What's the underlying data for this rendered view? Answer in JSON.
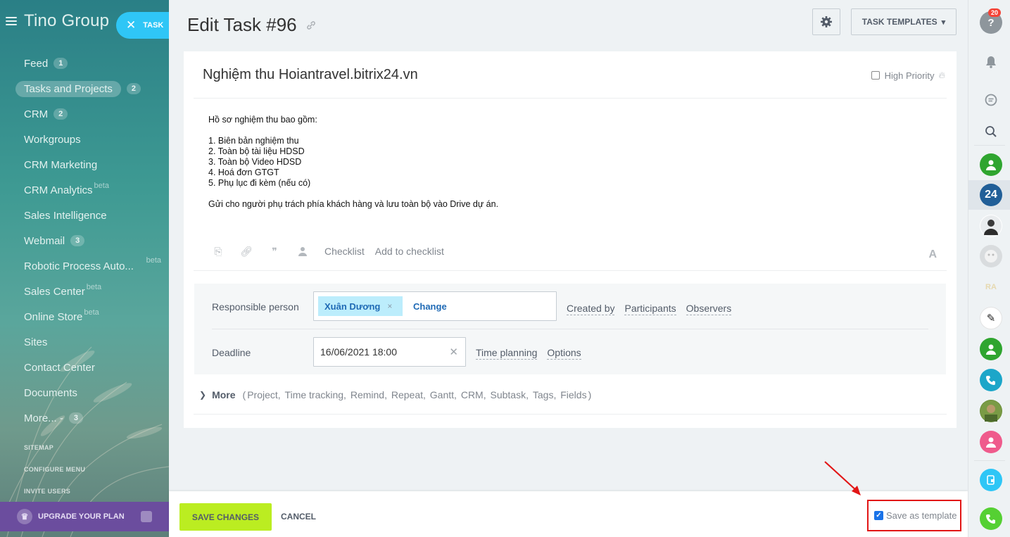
{
  "sidebar": {
    "logo": "Tino Group",
    "task_button": "TASK",
    "menu": [
      {
        "label": "Feed",
        "badge": "1",
        "beta": ""
      },
      {
        "label": "Tasks and Projects",
        "badge": "2",
        "beta": ""
      },
      {
        "label": "CRM",
        "badge": "2",
        "beta": ""
      },
      {
        "label": "Workgroups",
        "badge": "",
        "beta": ""
      },
      {
        "label": "CRM Marketing",
        "badge": "",
        "beta": ""
      },
      {
        "label": "CRM Analytics",
        "badge": "",
        "beta": "beta"
      },
      {
        "label": "Sales Intelligence",
        "badge": "",
        "beta": ""
      },
      {
        "label": "Webmail",
        "badge": "3",
        "beta": ""
      },
      {
        "label": "Robotic Process Auto...",
        "badge": "",
        "beta": "beta"
      },
      {
        "label": "Sales Center",
        "badge": "",
        "beta": "beta"
      },
      {
        "label": "Online Store",
        "badge": "",
        "beta": "beta"
      },
      {
        "label": "Sites",
        "badge": "",
        "beta": ""
      },
      {
        "label": "Contact Center",
        "badge": "",
        "beta": ""
      },
      {
        "label": "Documents",
        "badge": "",
        "beta": ""
      },
      {
        "label": "More... -",
        "badge": "3",
        "beta": ""
      }
    ],
    "sitemap": "SITEMAP",
    "configure_menu": "CONFIGURE MENU",
    "invite_users": "INVITE USERS",
    "upgrade": "UPGRADE YOUR PLAN"
  },
  "header": {
    "title": "Edit Task #96",
    "templates_button": "TASK TEMPLATES"
  },
  "task": {
    "title": "Nghiệm thu Hoiantravel.bitrix24.vn",
    "high_priority": "High Priority",
    "body": {
      "intro": "Hồ sơ nghiệm thu bao gồm:",
      "items": [
        "1. Biên bản nghiệm thu",
        "2. Toàn bộ tài liệu HDSD",
        "3. Toàn bộ Video HDSD",
        "4. Hoá đơn GTGT",
        "5. Phụ lục đi kèm (nếu có)"
      ],
      "outro": "Gửi cho người phụ trách phía khách hàng và lưu toàn bộ vào Drive dự án."
    },
    "toolbar": {
      "checklist": "Checklist",
      "add_to_checklist": "Add to checklist",
      "font_toggle": "A"
    }
  },
  "fields": {
    "responsible_label": "Responsible person",
    "responsible_name": "Xuân Dương",
    "change": "Change",
    "created_by": "Created by",
    "participants": "Participants",
    "observers": "Observers",
    "deadline_label": "Deadline",
    "deadline_value": "16/06/2021 18:00",
    "time_planning": "Time planning",
    "options": "Options"
  },
  "more": {
    "label": "More",
    "open_paren": "(",
    "close_paren": ")",
    "options": [
      "Project,",
      "Time tracking,",
      "Remind,",
      "Repeat,",
      "Gantt,",
      "CRM,",
      "Subtask,",
      "Tags,",
      "Fields"
    ]
  },
  "footer": {
    "save": "SAVE CHANGES",
    "cancel": "CANCEL",
    "save_as_template": "Save as template"
  },
  "rightbar": {
    "notification_count": "20",
    "b24_label": "24"
  },
  "colors": {
    "accent": "#2fc6f6",
    "save_button": "#bbed21",
    "highlight_box": "#e21616",
    "link": "#1f6ab5"
  }
}
